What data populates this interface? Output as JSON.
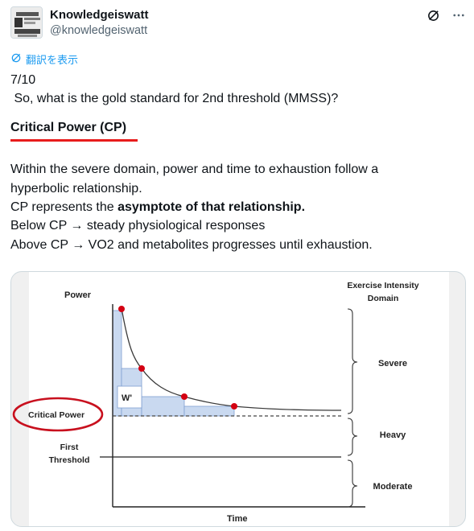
{
  "author": {
    "name": "Knowledgeiswatt",
    "handle": "@knowledgeiswatt"
  },
  "translate_label": "翻訳を表示",
  "post": {
    "counter": "7/10",
    "question": " So, what is the gold standard for 2nd threshold (MMSS)?",
    "heading": "Critical Power (CP)",
    "para1_line1": "Within the severe domain, power and time to exhaustion follow a",
    "para1_line2": "hyperbolic relationship.",
    "para2_prefix": "CP represents the ",
    "para2_bold": "asymptote of that relationship.",
    "para3": "Below CP → steady physiological responses",
    "para4": "Above CP → VO2 and metabolites progresses until exhaustion."
  },
  "figure": {
    "y_axis_label": "Power",
    "x_axis_label": "Time",
    "domain_title_line1": "Exercise Intensity",
    "domain_title_line2": "Domain",
    "critical_power_label": "Critical Power",
    "first_threshold_line1": "First",
    "first_threshold_line2": "Threshold",
    "w_prime_label": "W'",
    "domains": [
      "Severe",
      "Heavy",
      "Moderate"
    ],
    "colors": {
      "curve": "#3a3a3a",
      "points": "#d40012",
      "highlight_circle": "#c8101e",
      "box_fill": "#c9d9f0",
      "box_stroke": "#7f9fd1"
    }
  },
  "icons": [
    "grok-icon",
    "more-icon",
    "translate-icon"
  ]
}
